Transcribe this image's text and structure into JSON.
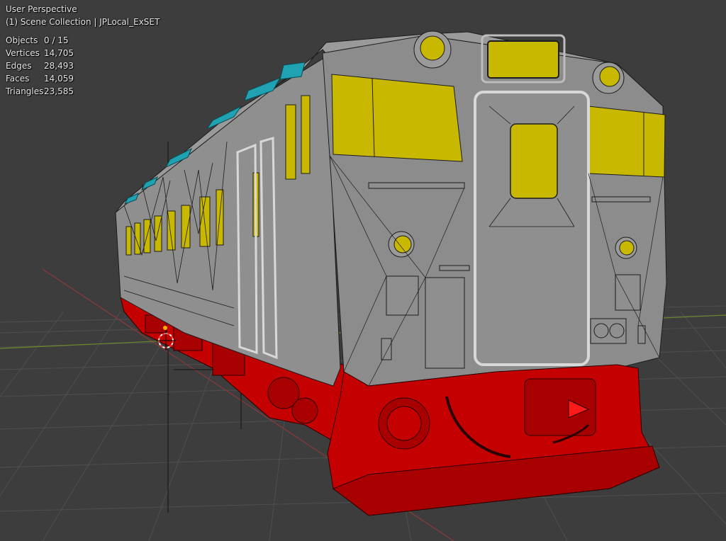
{
  "viewport": {
    "view_name": "User Perspective",
    "collection_path": "(1) Scene Collection | JPLocal_ExSET"
  },
  "statistics": {
    "rows": [
      {
        "label": "Objects",
        "value": "0 / 15"
      },
      {
        "label": "Vertices",
        "value": "14,705"
      },
      {
        "label": "Edges",
        "value": "28,493"
      },
      {
        "label": "Faces",
        "value": "14,059"
      },
      {
        "label": "Triangles",
        "value": "23,585"
      }
    ]
  },
  "scene": {
    "object_name": "JPLocal_ExSET",
    "background_color": "#3d3d3d",
    "grid_color": "#4f4f4f",
    "body_color": "#8f8f8f",
    "window_color": "#c9b800",
    "underframe_color": "#c40000",
    "roof_accent_color": "#1fa3b3",
    "wire_color": "#1c1c1c",
    "x_axis_color": "#8a3a3a",
    "y_axis_color": "#6b8a2a"
  },
  "cursor": {
    "icon": "3d-cursor-icon"
  }
}
